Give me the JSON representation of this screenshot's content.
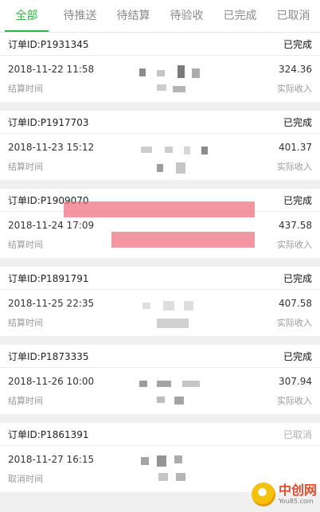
{
  "tabs": [
    "全部",
    "待推送",
    "待结算",
    "待验收",
    "已完成",
    "已取消"
  ],
  "active_tab": 0,
  "orders": [
    {
      "id": "订单ID:P1931345",
      "status": "已完成",
      "time": "2018-11-22 11:58",
      "amount": "324.36",
      "time_label": "结算时间",
      "amount_label": "实际收入"
    },
    {
      "id": "订单ID:P1917703",
      "status": "已完成",
      "time": "2018-11-23 15:12",
      "amount": "401.37",
      "time_label": "结算时间",
      "amount_label": "实际收入"
    },
    {
      "id": "订单ID:P1909070",
      "status": "已完成",
      "time": "2018-11-24 17:09",
      "amount": "437.58",
      "time_label": "结算时间",
      "amount_label": "实际收入"
    },
    {
      "id": "订单ID:P1891791",
      "status": "已完成",
      "time": "2018-11-25 22:35",
      "amount": "407.58",
      "time_label": "结算时间",
      "amount_label": "实际收入"
    },
    {
      "id": "订单ID:P1873335",
      "status": "已完成",
      "time": "2018-11-26 10:00",
      "amount": "307.94",
      "time_label": "结算时间",
      "amount_label": "实际收入"
    },
    {
      "id": "订单ID:P1861391",
      "status": "已取消",
      "time": "2018-11-27 16:15",
      "amount": "",
      "time_label": "取消时间",
      "amount_label": ""
    }
  ],
  "watermark": {
    "main": "中创网",
    "sub": "You85.com"
  },
  "colors": {
    "accent": "#2eb83a",
    "muted": "#9a9a9a",
    "banner": "#f06a7a"
  }
}
